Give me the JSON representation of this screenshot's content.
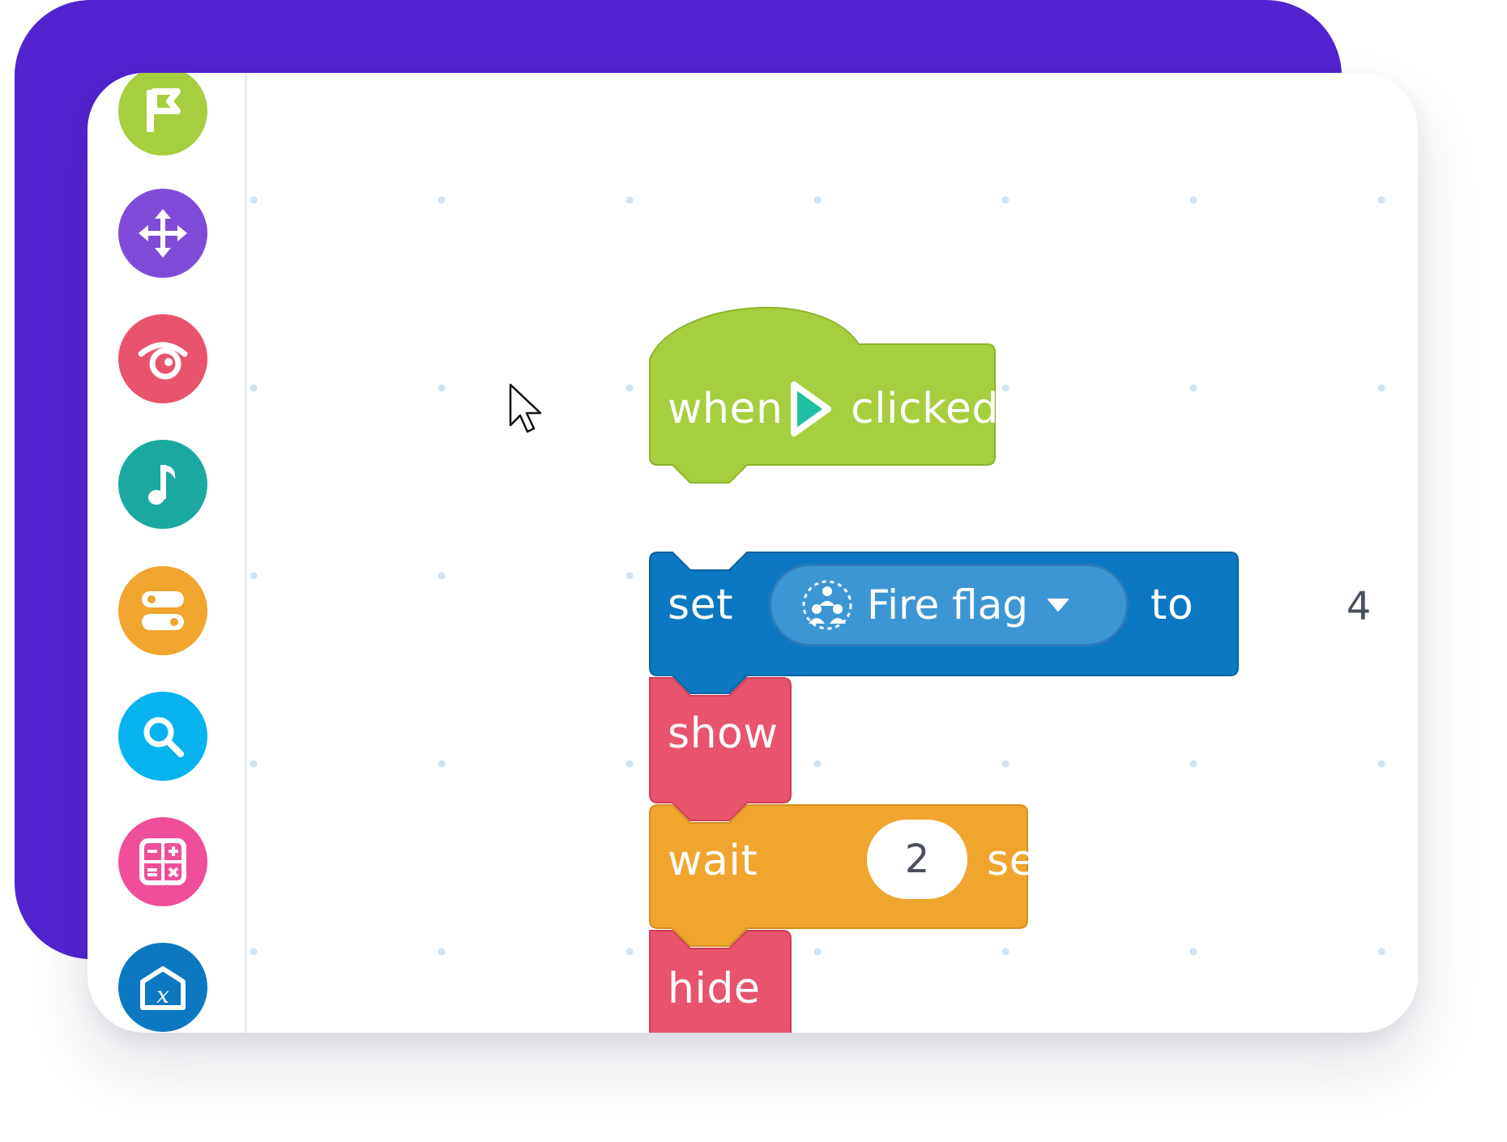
{
  "categories": [
    {
      "name": "events",
      "icon": "flag-icon",
      "color": "#A6CE3F"
    },
    {
      "name": "motion",
      "icon": "move-arrows-icon",
      "color": "#7F4CD9"
    },
    {
      "name": "looks",
      "icon": "eye-icon",
      "color": "#E8546B"
    },
    {
      "name": "sound",
      "icon": "music-note-icon",
      "color": "#1BA8A0"
    },
    {
      "name": "control",
      "icon": "toggle-icon",
      "color": "#F0A52F"
    },
    {
      "name": "sensing",
      "icon": "magnifier-icon",
      "color": "#06B3EE"
    },
    {
      "name": "operators",
      "icon": "calculator-icon",
      "color": "#EF4E98"
    },
    {
      "name": "variables",
      "icon": "variable-box-icon",
      "color": "#0C78C2"
    }
  ],
  "script": {
    "hat": {
      "word1": "when",
      "word2": "clicked",
      "icon": "play-flag-icon",
      "color": "#A6CE3F"
    },
    "set": {
      "label": "set",
      "variable": "Fire flag",
      "to_label": "to",
      "value": "4",
      "color": "#0C78C2"
    },
    "show": {
      "label": "show",
      "color": "#E8546B"
    },
    "wait": {
      "label": "wait",
      "value": "2",
      "unit": "seconds",
      "color": "#F0A52F"
    },
    "hide": {
      "label": "hide",
      "color": "#E8546B"
    }
  }
}
